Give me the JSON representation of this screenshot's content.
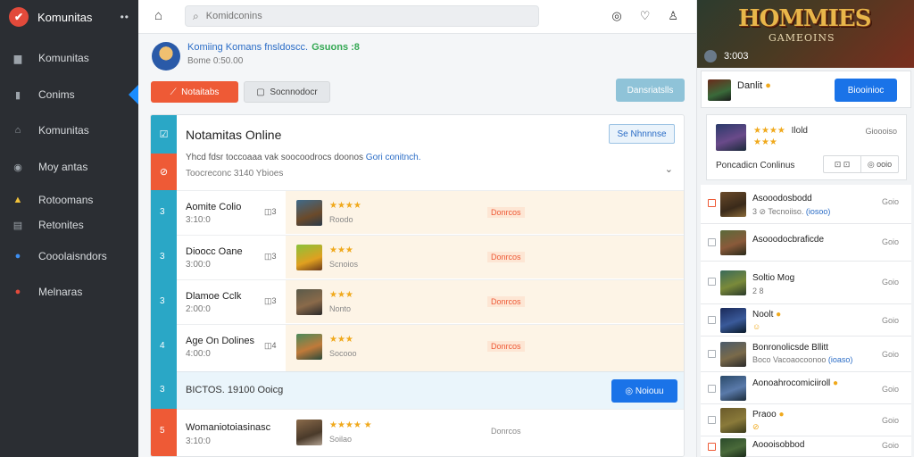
{
  "sidebar": {
    "brand": "Komunitas",
    "dots": "••",
    "items": [
      {
        "label": "Komunitas",
        "icon": "▆"
      },
      {
        "label": "Conims",
        "icon": "▮"
      },
      {
        "label": "Komunitas",
        "icon": "⌂"
      },
      {
        "label": "Moy antas",
        "icon": "◉"
      },
      {
        "label": "Rotoomans",
        "icon": "▲"
      },
      {
        "label": "Retonites",
        "icon": "▤"
      },
      {
        "label": "Cooolaisndors",
        "icon": "●"
      },
      {
        "label": "Melnaras",
        "icon": "●"
      }
    ]
  },
  "topbar": {
    "search_placeholder": "Komidconins",
    "home_icon": "⌂",
    "icons": [
      "◎",
      "♡",
      "♙"
    ]
  },
  "profile": {
    "title": "Komiing Komans fnsldoscc.",
    "status": "Gsuons :8",
    "subtitle": "Bome  0:50.00"
  },
  "actions": {
    "primary": "Notaitabs",
    "secondary": "Socnnodocr",
    "right": "Dansriatslls"
  },
  "card": {
    "title": "Notamitas Online",
    "action": "Se Nhnnnse",
    "description": "Yhcd fdsr toccoaaa vak soocoodrocs doonos",
    "description_link": "Gori conitnch.",
    "count": "Toocreconc 3140 Ybioes",
    "strip_icons": [
      "☑",
      "⊘"
    ],
    "rows": [
      {
        "name": "Aomite Colio",
        "id": "3:10:0",
        "side": "◫3",
        "num": "3",
        "stars": "★★★★",
        "sub": "Roodo",
        "tag": "Donrcos",
        "tag_style": "hi"
      },
      {
        "name": "Dioocc Oane",
        "id": "3:00:0",
        "side": "◫3",
        "num": "3",
        "stars": "★★★",
        "sub": "Scnoios",
        "tag": "Donrcos",
        "tag_style": "hi"
      },
      {
        "name": "Dlamoe Cclk",
        "id": "2:00:0",
        "side": "◫3",
        "num": "3",
        "stars": "★★★",
        "sub": "Nonto",
        "tag": "Donrcos",
        "tag_style": "hi"
      },
      {
        "name": "Age On Dolines",
        "id": "4:00:0",
        "side": "◫4",
        "num": "4",
        "stars": "★★★",
        "sub": "Socooo",
        "tag": "Donrcos",
        "tag_style": "hi"
      }
    ],
    "summary": {
      "num": "3",
      "text": "BICTOS. 19100  Ooicg",
      "button": "◎ Noiouu"
    },
    "last_row": {
      "name": "Womaniotoiasinasc",
      "id": "3:10:0",
      "num": "5",
      "stars": "★★★★  ★",
      "sub": "Soilao",
      "tag": "Donrcos",
      "tag_style": "plain"
    }
  },
  "right_panel": {
    "banner_title": "HOMMIES",
    "banner_subtitle": "GAMEOINS",
    "banner_id": "3:003",
    "card1": {
      "title": "Danlit",
      "button": "Biooinioc"
    },
    "card2": {
      "stars": "★★★★",
      "title": "Ilold",
      "stars2": "★★★",
      "right": "Gioooiso",
      "bottom": "Poncadicn Conlinus",
      "ctl_left": "⊡ ⊡",
      "ctl_right": "◎ ooio"
    },
    "list": [
      {
        "name": "Asooodosbodd",
        "sub": "3 ⊘ Tecnoiiso.",
        "link": "(iosoo)",
        "right": "Goio",
        "checked": true
      },
      {
        "name": "Asooodocbraficde",
        "sub": "",
        "link": "",
        "right": "Goio",
        "checked": false
      },
      {
        "name": "Soltio Mog",
        "sub": "2  8",
        "link": "",
        "right": "Goio",
        "checked": false
      },
      {
        "name": "Noolt",
        "sub": "☺",
        "link": "",
        "right": "Goio",
        "checked": false
      },
      {
        "name": "Bonronolicsde Bllitt",
        "sub": "Boco Vacoaocoonoo",
        "link": "(ioaso)",
        "right": "Goio",
        "checked": false
      },
      {
        "name": "Aonoahrocomiciiroll",
        "sub": "",
        "link": "",
        "right": "Goio",
        "checked": false
      },
      {
        "name": "Praoo",
        "sub": "⊘",
        "link": "",
        "right": "Goio",
        "checked": false
      },
      {
        "name": "Aoooisobbod",
        "sub": "",
        "link": "",
        "right": "Goio",
        "checked": true
      }
    ]
  },
  "colors": {
    "accent_blue": "#1a73e8",
    "accent_red": "#ee5a36",
    "teal": "#2aa7c6",
    "sidebar": "#2b2e33"
  }
}
